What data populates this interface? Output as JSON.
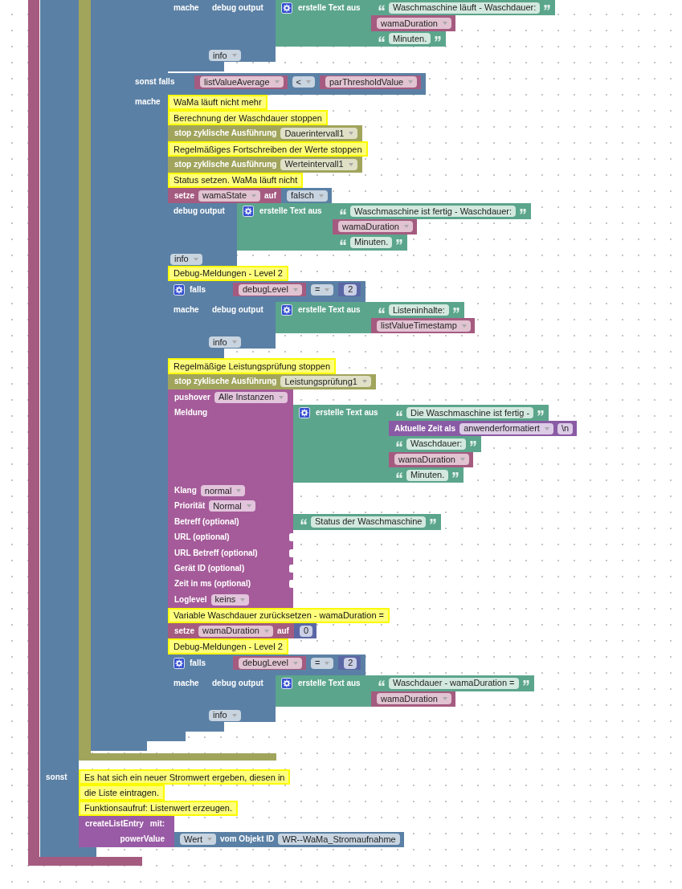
{
  "workspace": {
    "blocks": [
      {
        "kind": "trigger",
        "body": [
          {
            "kind": "if",
            "rows": [
              {
                "kind": "statement",
                "body": [
                  {
                    "kind": "interval",
                    "body": [
                      {
                        "kind": "if",
                        "rows": [
                          {
                            "kind": "statement",
                            "body": [
                              {
                                "kind": "if",
                                "rows": [
                                  {
                                    "kind": "statement",
                                    "body": [
                                      {
                                        "kind": "if",
                                        "rows": [
                                          {
                                            "kind": "statement",
                                            "label": "mache",
                                            "body": [
                                              {
                                                "kind": "debug",
                                                "label": "debug output",
                                                "log_level": "info",
                                                "value": {
                                                  "kind": "join",
                                                  "label": "erstelle Text aus",
                                                  "items": [
                                                    {
                                                      "kind": "text",
                                                      "text": "Waschmaschine läuft - Waschdauer:"
                                                    },
                                                    {
                                                      "kind": "variable",
                                                      "name": "wamaDuration"
                                                    },
                                                    {
                                                      "kind": "text",
                                                      "text": "Minuten."
                                                    }
                                                  ]
                                                }
                                              }
                                            ]
                                          }
                                        ]
                                      }
                                    ]
                                  },
                                  {
                                    "kind": "value",
                                    "label": "sonst falls",
                                    "value": {
                                      "kind": "compare",
                                      "left": {
                                        "kind": "variable",
                                        "name": "listValueAverage"
                                      },
                                      "op": "<",
                                      "right": {
                                        "kind": "variable",
                                        "name": "parThresholdValue"
                                      }
                                    }
                                  },
                                  {
                                    "kind": "statement",
                                    "label": "mache",
                                    "body": [
                                      {
                                        "kind": "comment",
                                        "text": "WaMa läuft nicht mehr"
                                      },
                                      {
                                        "kind": "comment",
                                        "text": "Berechnung der Waschdauer stoppen"
                                      },
                                      {
                                        "kind": "stop_interval",
                                        "label": "stop zyklische Ausführung",
                                        "target": "Dauerintervall1"
                                      },
                                      {
                                        "kind": "comment",
                                        "text": "Regelmäßiges Fortschreiben der Werte stoppen"
                                      },
                                      {
                                        "kind": "stop_interval",
                                        "label": "stop zyklische Ausführung",
                                        "target": "Werteintervall1"
                                      },
                                      {
                                        "kind": "comment",
                                        "text": "Status setzen. WaMa läuft nicht"
                                      },
                                      {
                                        "kind": "set",
                                        "label": "setze",
                                        "variable": "wamaState",
                                        "connector": "auf",
                                        "value": {
                                          "kind": "boolean",
                                          "value": "falsch"
                                        }
                                      },
                                      {
                                        "kind": "debug",
                                        "label": "debug output",
                                        "log_level": "info",
                                        "value": {
                                          "kind": "join",
                                          "label": "erstelle Text aus",
                                          "items": [
                                            {
                                              "kind": "text",
                                              "text": "Waschmaschine ist fertig - Waschdauer:"
                                            },
                                            {
                                              "kind": "variable",
                                              "name": "wamaDuration"
                                            },
                                            {
                                              "kind": "text",
                                              "text": "Minuten."
                                            }
                                          ]
                                        }
                                      },
                                      {
                                        "kind": "comment",
                                        "text": "Debug-Meldungen - Level 2"
                                      },
                                      {
                                        "kind": "if",
                                        "rows": [
                                          {
                                            "kind": "value",
                                            "label": "falls",
                                            "value": {
                                              "kind": "compare",
                                              "left": {
                                                "kind": "variable",
                                                "name": "debugLevel"
                                              },
                                              "op": "=",
                                              "right": {
                                                "kind": "number",
                                                "value": "2"
                                              }
                                            }
                                          },
                                          {
                                            "kind": "statement",
                                            "label": "mache",
                                            "body": [
                                              {
                                                "kind": "debug",
                                                "label": "debug output",
                                                "log_level": "info",
                                                "value": {
                                                  "kind": "join",
                                                  "label": "erstelle Text aus",
                                                  "items": [
                                                    {
                                                      "kind": "text",
                                                      "text": "Listeninhalte:"
                                                    },
                                                    {
                                                      "kind": "variable",
                                                      "name": "listValueTimestamp"
                                                    }
                                                  ]
                                                }
                                              }
                                            ]
                                          }
                                        ]
                                      },
                                      {
                                        "kind": "comment",
                                        "text": "Regelmäßige Leistungsprüfung stoppen"
                                      },
                                      {
                                        "kind": "stop_interval",
                                        "label": "stop zyklische Ausführung",
                                        "target": "Leistungsprüfung1"
                                      },
                                      {
                                        "kind": "pushover",
                                        "rows": [
                                          {
                                            "kind": "field",
                                            "label": "pushover",
                                            "option": "Alle Instanzen"
                                          },
                                          {
                                            "kind": "input",
                                            "label": "Meldung",
                                            "value": {
                                              "kind": "join",
                                              "label": "erstelle Text aus",
                                              "items": [
                                                {
                                                  "kind": "text",
                                                  "text": "Die Waschmaschine ist fertig -"
                                                },
                                                {
                                                  "kind": "time",
                                                  "label": "Aktuelle Zeit als",
                                                  "format": "anwenderformatiert",
                                                  "suffix": "\\n"
                                                },
                                                {
                                                  "kind": "text",
                                                  "text": "Waschdauer:"
                                                },
                                                {
                                                  "kind": "variable",
                                                  "name": "wamaDuration"
                                                },
                                                {
                                                  "kind": "text",
                                                  "text": "Minuten."
                                                }
                                              ]
                                            }
                                          },
                                          {
                                            "kind": "field",
                                            "label": "Klang",
                                            "option": "normal"
                                          },
                                          {
                                            "kind": "field",
                                            "label": "Priorität",
                                            "option": "Normal"
                                          },
                                          {
                                            "kind": "input",
                                            "label": "Betreff (optional)",
                                            "value": {
                                              "kind": "text",
                                              "text": "Status der Waschmaschine"
                                            }
                                          },
                                          {
                                            "kind": "input",
                                            "label": "URL (optional)"
                                          },
                                          {
                                            "kind": "input",
                                            "label": "URL Betreff (optional)"
                                          },
                                          {
                                            "kind": "input",
                                            "label": "Gerät ID (optional)"
                                          },
                                          {
                                            "kind": "input",
                                            "label": "Zeit in ms (optional)"
                                          },
                                          {
                                            "kind": "field",
                                            "label": "Loglevel",
                                            "option": "keins"
                                          }
                                        ]
                                      },
                                      {
                                        "kind": "comment",
                                        "text": "Variable Waschdauer zurücksetzen - wamaDuration ="
                                      },
                                      {
                                        "kind": "set",
                                        "label": "setze",
                                        "variable": "wamaDuration",
                                        "connector": "auf",
                                        "value": {
                                          "kind": "number",
                                          "value": "0"
                                        }
                                      },
                                      {
                                        "kind": "comment",
                                        "text": "Debug-Meldungen - Level 2"
                                      },
                                      {
                                        "kind": "if",
                                        "rows": [
                                          {
                                            "kind": "value",
                                            "label": "falls",
                                            "value": {
                                              "kind": "compare",
                                              "left": {
                                                "kind": "variable",
                                                "name": "debugLevel"
                                              },
                                              "op": "=",
                                              "right": {
                                                "kind": "number",
                                                "value": "2"
                                              }
                                            }
                                          },
                                          {
                                            "kind": "statement",
                                            "label": "mache",
                                            "body": [
                                              {
                                                "kind": "debug",
                                                "label": "debug output",
                                                "log_level": "info",
                                                "value": {
                                                  "kind": "join",
                                                  "label": "erstelle Text aus",
                                                  "items": [
                                                    {
                                                      "kind": "text",
                                                      "text": "Waschdauer - wamaDuration ="
                                                    },
                                                    {
                                                      "kind": "variable",
                                                      "name": "wamaDuration"
                                                    }
                                                  ]
                                                }
                                              }
                                            ]
                                          }
                                        ]
                                      }
                                    ]
                                  }
                                ]
                              }
                            ]
                          }
                        ]
                      }
                    ]
                  }
                ]
              },
              {
                "kind": "statement",
                "label": "sonst",
                "body": [
                  {
                    "kind": "comment",
                    "text": "Es hat sich ein neuer Stromwert ergeben, diesen in"
                  },
                  {
                    "kind": "comment",
                    "text": "die Liste eintragen."
                  },
                  {
                    "kind": "comment",
                    "text": "Funktionsaufruf: Listenwert erzeugen."
                  },
                  {
                    "kind": "call",
                    "label": "createListEntry",
                    "suffix": "mit:",
                    "args": [
                      {
                        "name": "powerValue",
                        "value": {
                          "kind": "get_state",
                          "attribute": "Wert",
                          "label": "vom Objekt ID",
                          "object_id": "WR--WaMa_Stromaufnahme"
                        }
                      }
                    ]
                  }
                ]
              }
            ]
          }
        ]
      }
    ]
  }
}
